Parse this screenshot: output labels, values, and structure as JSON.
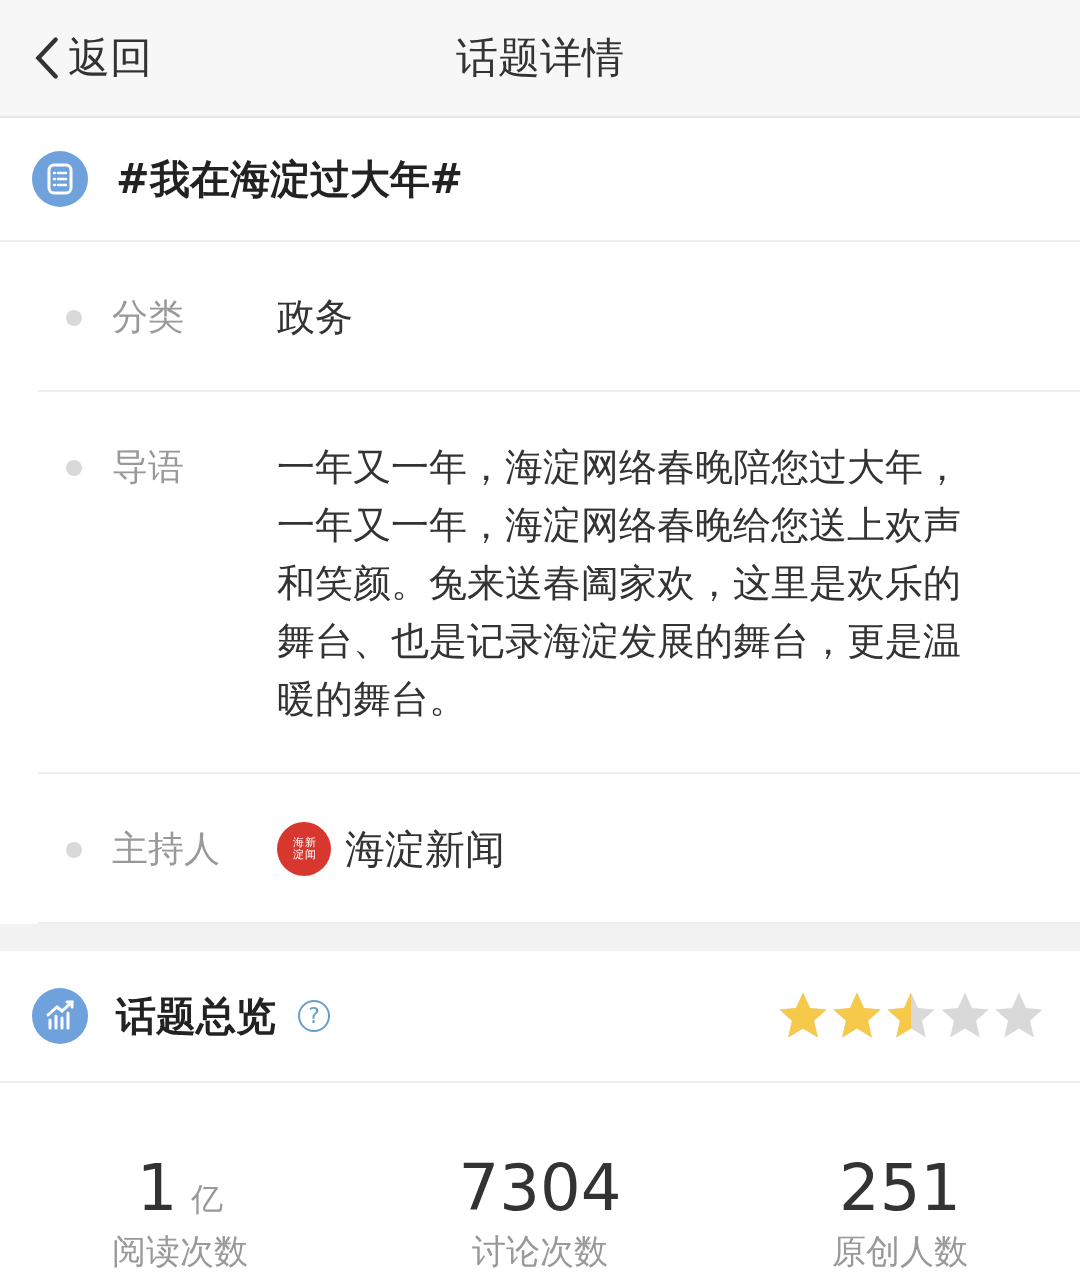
{
  "nav": {
    "back": "返回",
    "title": "话题详情"
  },
  "topic": {
    "title": "#我在海淀过大年#"
  },
  "details": [
    {
      "kind": "text",
      "label": "分类",
      "value": "政务"
    },
    {
      "kind": "text",
      "label": "导语",
      "value": "一年又一年，海淀网络春晚陪您过大年，一年又一年，海淀网络春晚给您送上欢声和笑颜。兔来送春阖家欢，这里是欢乐的舞台、也是记录海淀发展的舞台，更是温暖的舞台。"
    },
    {
      "kind": "host",
      "label": "主持人",
      "value": "海淀新闻",
      "seal": [
        "海淀",
        "新闻"
      ]
    }
  ],
  "overview": {
    "title": "话题总览",
    "help": "?",
    "stars": 2.5
  },
  "stats": [
    {
      "number": "1",
      "unit": "亿",
      "label": "阅读次数"
    },
    {
      "number": "7304",
      "label": "讨论次数"
    },
    {
      "number": "251",
      "label": "原创人数"
    }
  ]
}
